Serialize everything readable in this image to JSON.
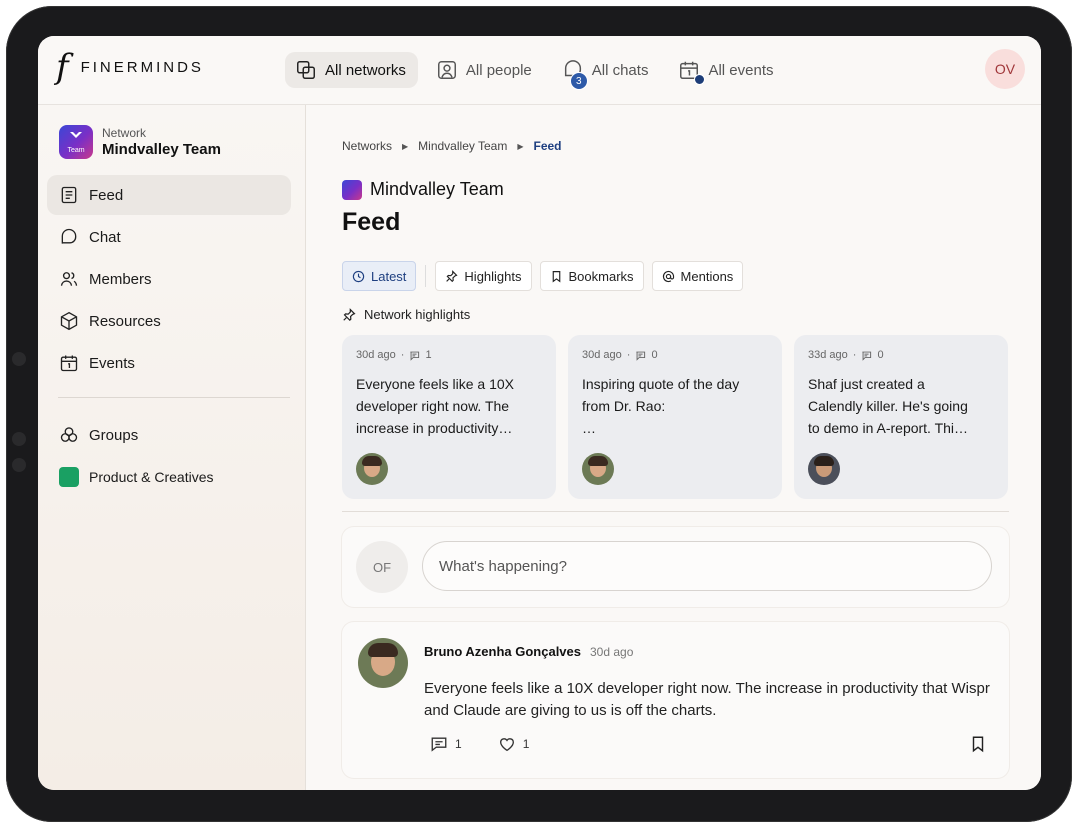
{
  "brand": {
    "mark": "f",
    "name": "FINERMINDS"
  },
  "topnav": [
    {
      "label": "All networks",
      "icon": "networks-icon",
      "active": true
    },
    {
      "label": "All people",
      "icon": "person-icon"
    },
    {
      "label": "All chats",
      "icon": "chat-icon",
      "badge": "3"
    },
    {
      "label": "All events",
      "icon": "calendar-icon"
    }
  ],
  "user": {
    "initials": "OV"
  },
  "sidebar": {
    "network_caption": "Network",
    "network_name": "Mindvalley Team",
    "network_logo_text": "Team",
    "items": [
      {
        "label": "Feed",
        "icon": "feed-icon",
        "active": true
      },
      {
        "label": "Chat",
        "icon": "chat-icon"
      },
      {
        "label": "Members",
        "icon": "members-icon"
      },
      {
        "label": "Resources",
        "icon": "cube-icon"
      },
      {
        "label": "Events",
        "icon": "calendar-icon"
      }
    ],
    "groups_label": "Groups",
    "group_items": [
      {
        "label": "Product & Creatives",
        "color": "#1aa063"
      }
    ]
  },
  "breadcrumb": [
    "Networks",
    "Mindvalley Team",
    "Feed"
  ],
  "main": {
    "network_name": "Mindvalley Team",
    "page_title": "Feed",
    "tabs": [
      "Latest",
      "Highlights",
      "Bookmarks",
      "Mentions"
    ],
    "highlights_label": "Network highlights",
    "highlights": [
      {
        "age": "30d ago",
        "comments": "1",
        "lines": [
          "Everyone feels like a 10X",
          "developer right now. The",
          "increase in productivity…"
        ]
      },
      {
        "age": "30d ago",
        "comments": "0",
        "lines": [
          "Inspiring quote of the day",
          "from Dr. Rao:",
          "…"
        ]
      },
      {
        "age": "33d ago",
        "comments": "0",
        "lines": [
          "Shaf just created a",
          "Calendly killer. He's going",
          "to demo in A-report. Thi…"
        ]
      }
    ],
    "composer": {
      "initials": "OF",
      "placeholder": "What's happening?"
    },
    "post": {
      "author": "Bruno Azenha Gonçalves",
      "time": "30d ago",
      "body": "Everyone feels like a 10X developer right now. The increase in productivity that Wispr and Claude are giving to us is off the charts.",
      "comments": "1",
      "likes": "1"
    }
  },
  "colors": {
    "accent": "#1e3f80",
    "badge": "#2e5aa8",
    "avatar_bg": "#f9dedc"
  }
}
